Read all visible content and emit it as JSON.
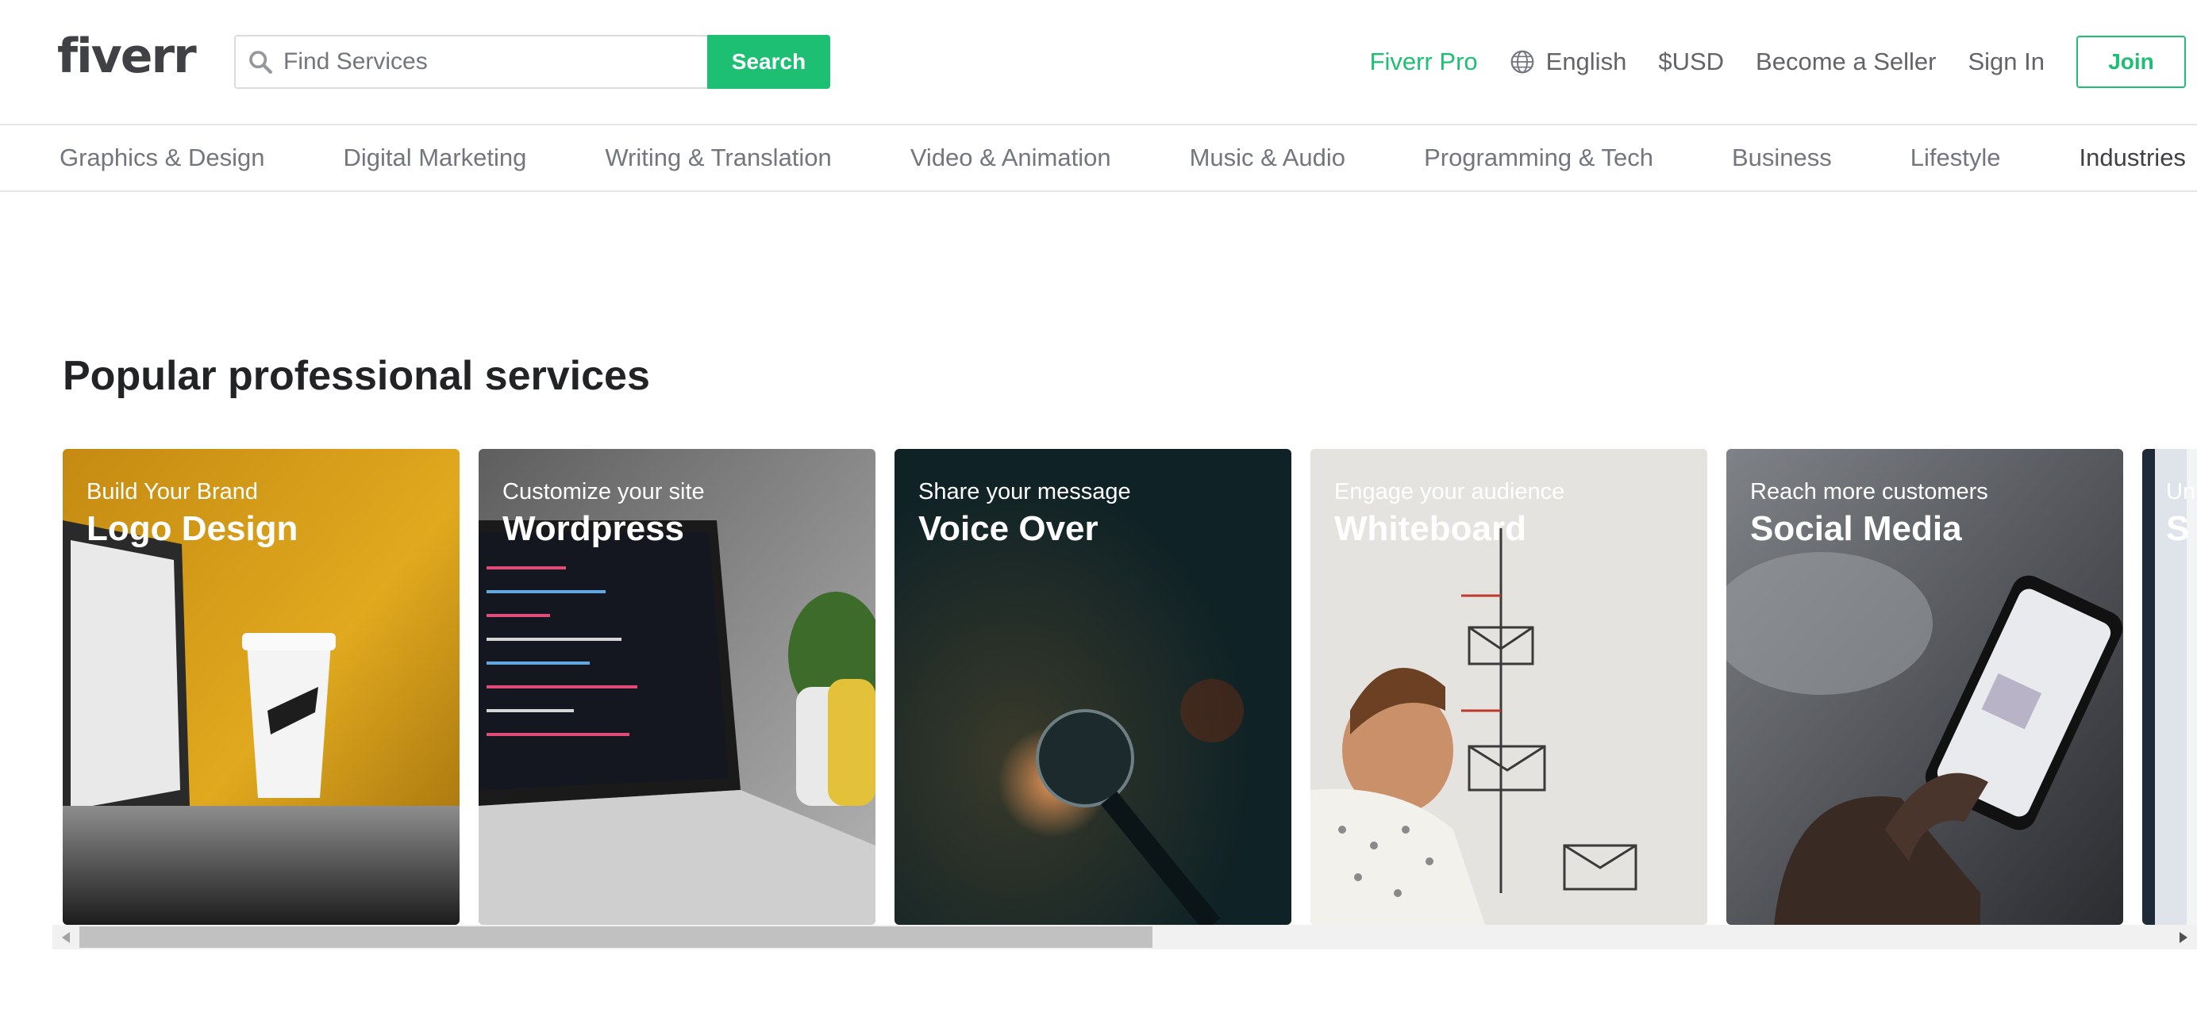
{
  "header": {
    "logo": "fiverr",
    "search_placeholder": "Find Services",
    "search_button": "Search",
    "nav": {
      "pro": "Fiverr Pro",
      "language": "English",
      "currency": "$USD",
      "become_seller": "Become a Seller",
      "sign_in": "Sign In",
      "join": "Join"
    }
  },
  "categories": [
    "Graphics & Design",
    "Digital Marketing",
    "Writing & Translation",
    "Video & Animation",
    "Music & Audio",
    "Programming & Tech",
    "Business",
    "Lifestyle",
    "Industries"
  ],
  "section": {
    "title": "Popular professional services",
    "cards": [
      {
        "subtitle": "Build Your Brand",
        "title": "Logo Design"
      },
      {
        "subtitle": "Customize your site",
        "title": "Wordpress"
      },
      {
        "subtitle": "Share your message",
        "title": "Voice Over"
      },
      {
        "subtitle": "Engage your audience",
        "title": "Whiteboard"
      },
      {
        "subtitle": "Reach more customers",
        "title": "Social Media"
      },
      {
        "subtitle": "Un",
        "title": "S"
      }
    ]
  },
  "colors": {
    "brand_green": "#1dbf73",
    "text_dark": "#222325",
    "text_muted": "#74767e"
  },
  "icons": {
    "search": "search-icon",
    "language": "globe-icon",
    "scroll_left": "triangle-left-icon",
    "scroll_right": "triangle-right-icon"
  }
}
